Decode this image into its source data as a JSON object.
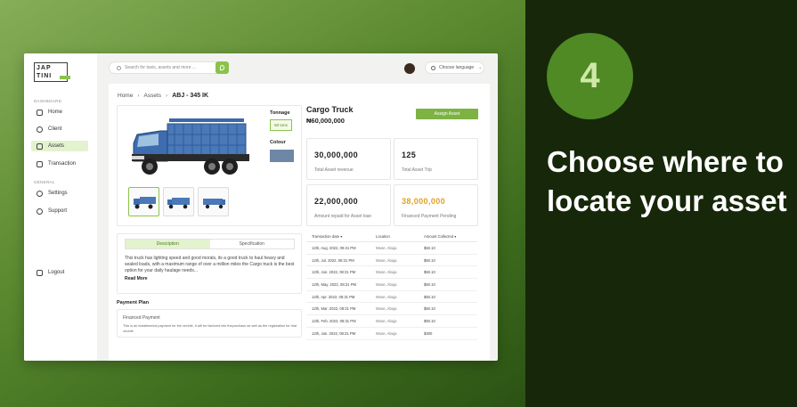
{
  "promo": {
    "step_number": "4",
    "headline": "Choose where to locate your asset"
  },
  "sidebar": {
    "logo_line1": "JAP",
    "logo_line2": "TINI",
    "section_dashboard": "DASHBOARD",
    "section_general": "GENERAL",
    "items": [
      {
        "label": "Home",
        "icon": "home-icon"
      },
      {
        "label": "Client",
        "icon": "users-icon"
      },
      {
        "label": "Assets",
        "icon": "truck-icon"
      },
      {
        "label": "Transaction",
        "icon": "receipt-icon"
      }
    ],
    "general_items": [
      {
        "label": "Settings",
        "icon": "gear-icon"
      },
      {
        "label": "Support",
        "icon": "chat-icon"
      }
    ],
    "logout": "Logout"
  },
  "topbar": {
    "search_placeholder": "Search for taxis, assets and more ...",
    "language": "Choose language"
  },
  "breadcrumb": {
    "home": "Home",
    "assets": "Assets",
    "current": "ABJ - 345 IK"
  },
  "asset": {
    "tonnage_label": "Tonnage",
    "tonnage_value": "50 tons",
    "colour_label": "Colour",
    "colour_hex": "#6e87a6",
    "title": "Cargo Truck",
    "price": "₦60,000,000",
    "assign_button": "Assign Asset"
  },
  "tabs": {
    "description": "Description",
    "specification": "Specification"
  },
  "description": {
    "text": "This truck has lighting speed and good morals, its a good truck to haul heavy and sealed loads, with a maximum range of over a million miles the Cargo truck is the best option for your daily haulage needs...",
    "read_more": "Read More"
  },
  "payment_plan": {
    "title": "Payment Plan",
    "plan_name": "Financed Payment",
    "plan_text": "This is an installmental payment for the vechile, it will be factored into thepurchase as well as the registration for that vechile"
  },
  "stats": [
    {
      "value": "30,000,000",
      "label": "Total Asset revenue"
    },
    {
      "value": "125",
      "label": "Total Asset Trip"
    },
    {
      "value": "22,000,000",
      "label": "Amount repaid for Asset loan"
    },
    {
      "value": "38,000,000",
      "label": "Financed Payment Pending"
    }
  ],
  "transactions": {
    "headers": [
      "Transaction date ▾",
      "Location",
      "Amount Collected ▾"
    ],
    "rows": [
      [
        "12th, Aug. 2022, 09:31 PM",
        "Wuse, Abuja",
        "$50.10"
      ],
      [
        "12th, Jul. 2022, 08:31 PM",
        "Wuse, Abuja",
        "$50.10"
      ],
      [
        "12th, Jun. 2022, 08:31 PM",
        "Wuse, Abuja",
        "$50.10"
      ],
      [
        "12th, May. 2022, 08:31 PM",
        "Wuse, Abuja",
        "$50.10"
      ],
      [
        "12th, Apr. 2022, 08:31 PM",
        "Wuse, Abuja",
        "$50.10"
      ],
      [
        "12th, Mar. 2022, 08:31 PM",
        "Wuse, Abuja",
        "$50.10"
      ],
      [
        "12th, Feb. 2022, 08:31 PM",
        "Wuse, Abuja",
        "$50.10"
      ],
      [
        "12th, Jan. 2022, 08:31 PM",
        "Wuse, Abuja",
        "$300"
      ]
    ]
  },
  "colors": {
    "accent_green": "#7cb342",
    "pending_orange": "#e3a021",
    "dark_panel": "#17270a"
  }
}
